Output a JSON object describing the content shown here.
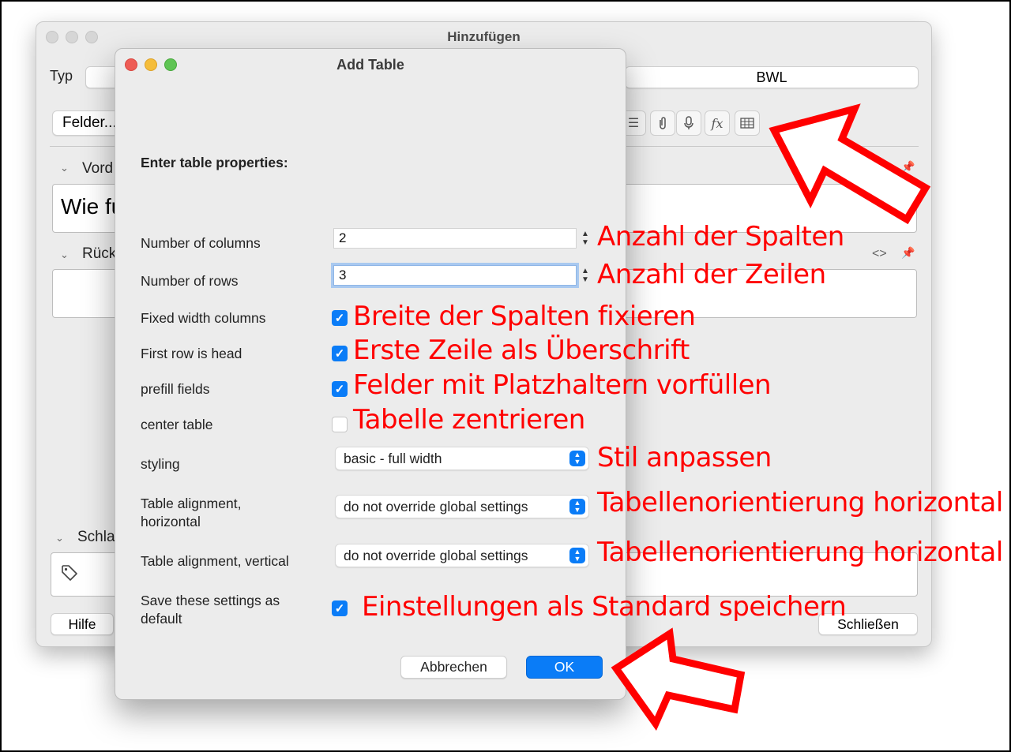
{
  "background_window": {
    "title": "Hinzufügen",
    "type_label": "Typ",
    "deck_value": "BWL",
    "fields_button": "Felder...",
    "front_section": "Vord",
    "front_content": "Wie fu",
    "back_section": "Rück",
    "tags_section": "Schla",
    "help_button": "Hilfe",
    "close_button": "Schließen",
    "toolbar_icons": [
      "list-icon",
      "paperclip-icon",
      "microphone-icon",
      "function-icon",
      "table-icon"
    ],
    "html_toggle": "<>"
  },
  "dialog": {
    "title": "Add Table",
    "section_header": "Enter table properties:",
    "columns_label": "Number of columns",
    "columns_value": "2",
    "rows_label": "Number of rows",
    "rows_value": "3",
    "fixed_width_label": "Fixed width columns",
    "fixed_width_checked": true,
    "first_row_head_label": "First row is head",
    "first_row_head_checked": true,
    "prefill_label": "prefill fields",
    "prefill_checked": true,
    "center_label": "center table",
    "center_checked": false,
    "styling_label": "styling",
    "styling_value": "basic - full width",
    "align_h_label": "Table alignment, horizontal",
    "align_h_value": "do not override global settings",
    "align_v_label": "Table alignment, vertical",
    "align_v_value": "do not override global settings",
    "save_default_label": "Save these settings as default",
    "save_default_checked": true,
    "cancel_button": "Abbrechen",
    "ok_button": "OK"
  },
  "annotations": {
    "columns": "Anzahl der Spalten",
    "rows": "Anzahl der Zeilen",
    "fixed_width": "Breite der Spalten fixieren",
    "first_row": "Erste Zeile als Überschrift",
    "prefill": "Felder mit Platzhaltern vorfüllen",
    "center": "Tabelle zentrieren",
    "styling": "Stil anpassen",
    "align_h": "Tabellenorientierung horizontal",
    "align_v": "Tabellenorientierung horizontal",
    "save_default": "Einstellungen als Standard speichern",
    "color": "#ff0000"
  },
  "colors": {
    "accent": "#0a7cf7",
    "annotation": "#ff0000",
    "window_bg": "#ececec"
  }
}
